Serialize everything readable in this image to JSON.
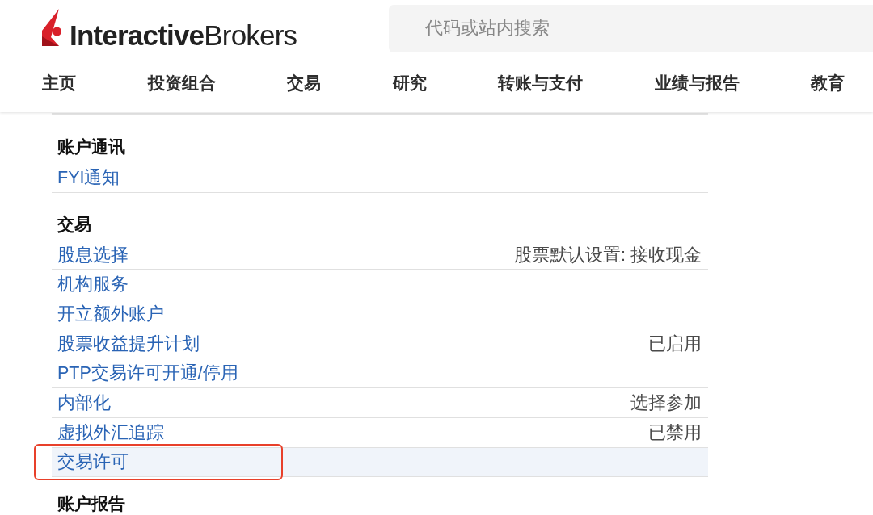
{
  "header": {
    "brand": "**Interactive**Brokers",
    "search": {
      "placeholder": "代码或站内搜索"
    }
  },
  "nav": [
    "主页",
    "投资组合",
    "交易",
    "研究",
    "转账与支付",
    "业绩与报告",
    "教育"
  ],
  "sections": [
    {
      "title": "账户通讯",
      "rows": [
        {
          "label": "FYI通知",
          "selected": false,
          "annotated": false
        }
      ]
    },
    {
      "title": "交易",
      "rows": [
        {
          "label": "股息选择",
          "value": "股票默认设置: 接收现金",
          "selected": false,
          "annotated": false
        },
        {
          "label": "机构服务",
          "selected": false,
          "annotated": false
        },
        {
          "label": "开立额外账户",
          "selected": false,
          "annotated": false
        },
        {
          "label": "股票收益提升计划",
          "value": "已启用",
          "selected": false,
          "annotated": false
        },
        {
          "label": "PTP交易许可开通/停用",
          "selected": false,
          "annotated": false
        },
        {
          "label": "内部化",
          "value": "选择参加",
          "selected": false,
          "annotated": false
        },
        {
          "label": "虚拟外汇追踪",
          "value": "已禁用",
          "selected": false,
          "annotated": false
        },
        {
          "label": "交易许可",
          "selected": true,
          "annotated": true
        }
      ]
    },
    {
      "title": "账户报告"
    }
  ]
}
